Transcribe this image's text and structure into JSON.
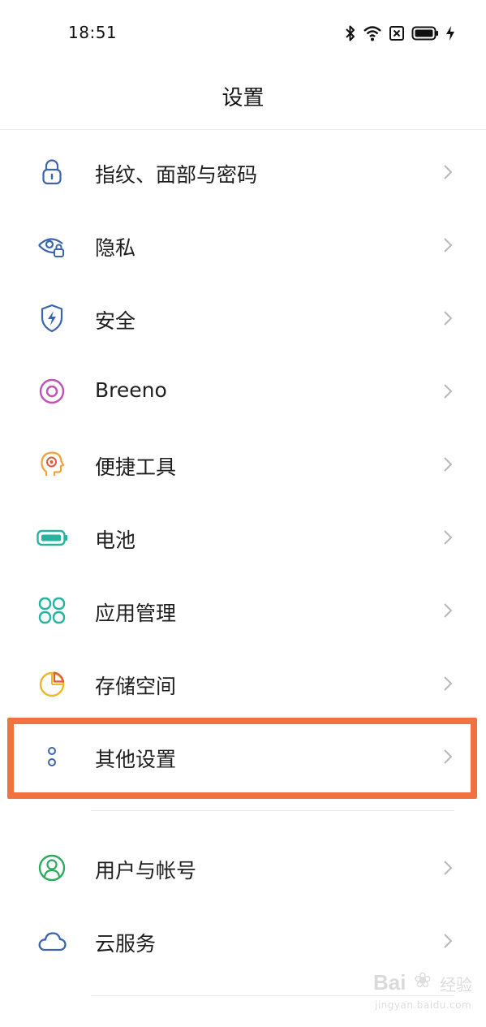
{
  "status_bar": {
    "time": "18:51",
    "icons": [
      "bluetooth-icon",
      "wifi-icon",
      "sim-disabled-icon",
      "battery-icon",
      "charging-icon"
    ]
  },
  "header": {
    "title": "设置"
  },
  "settings": {
    "items": [
      {
        "label": "指纹、面部与密码",
        "icon": "lock-icon",
        "color": "#3c64ad"
      },
      {
        "label": "隐私",
        "icon": "privacy-eye-icon",
        "color": "#3c64ad"
      },
      {
        "label": "安全",
        "icon": "security-shield-icon",
        "color": "#3c64ad"
      },
      {
        "label": "Breeno",
        "icon": "breeno-icon",
        "color": "#c052b5"
      },
      {
        "label": "便捷工具",
        "icon": "convenience-tools-icon",
        "color": "#f0a23a"
      },
      {
        "label": "电池",
        "icon": "battery-icon",
        "color": "#26b3a0"
      },
      {
        "label": "应用管理",
        "icon": "app-management-icon",
        "color": "#26b3a0"
      },
      {
        "label": "存储空间",
        "icon": "storage-pie-icon",
        "color": "#f0b62a"
      },
      {
        "label": "其他设置",
        "icon": "other-settings-icon",
        "color": "#3c64ad"
      }
    ],
    "account_items": [
      {
        "label": "用户与帐号",
        "icon": "user-account-icon",
        "color": "#2eaa5e"
      },
      {
        "label": "云服务",
        "icon": "cloud-icon",
        "color": "#3c64ad"
      }
    ]
  },
  "highlight": {
    "target": "其他设置",
    "color": "#f07241"
  },
  "watermark": {
    "brand": "Bai",
    "brand_cn": "经验",
    "url": "jingyan.baidu.com"
  }
}
